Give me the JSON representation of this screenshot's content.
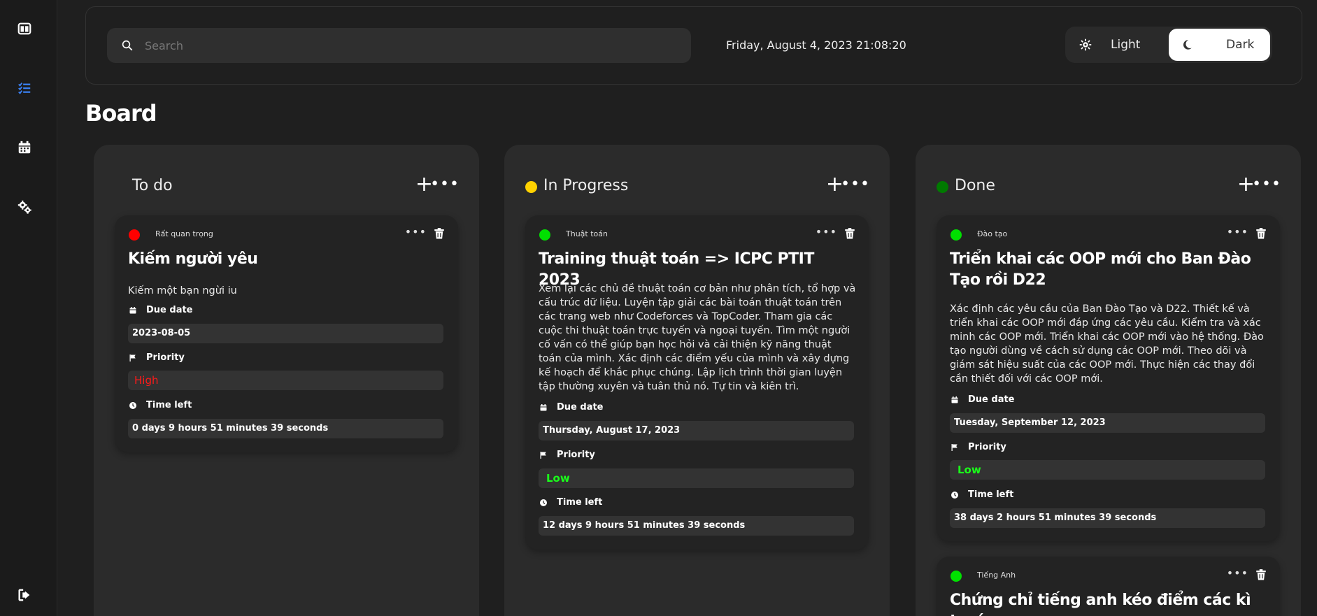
{
  "search": {
    "placeholder": "Search"
  },
  "header": {
    "datetime": "Friday, August 4, 2023 21:08:20"
  },
  "theme": {
    "light_label": "Light",
    "dark_label": "Dark"
  },
  "page": {
    "title": "Board"
  },
  "colors": {
    "red": "#ff0000",
    "green": "#00e000",
    "yellow": "#ffd200",
    "dark_green": "#007a00"
  },
  "columns": [
    {
      "title": "To do",
      "add": "+",
      "more": "•••",
      "cards": [
        {
          "category": "Rất quan trọng",
          "title": "Kiếm người yêu",
          "description": "Kiếm một bạn ngừi iu",
          "due_label": "Due date",
          "due_value": "2023-08-05",
          "priority_label": "Priority",
          "priority_value": "High",
          "time_label": "Time left",
          "time_value": "0 days 9 hours 51 minutes 39 seconds"
        }
      ]
    },
    {
      "title": "In Progress",
      "add": "+",
      "more": "•••",
      "cards": [
        {
          "category": "Thuật toán",
          "title": "Training thuật toán => ICPC PTIT 2023",
          "description": "Xem lại các chủ đề thuật toán cơ bản như phân tích, tổ hợp và cấu trúc dữ liệu. Luyện tập giải các bài toán thuật toán trên các trang web như Codeforces và TopCoder. Tham gia các cuộc thi thuật toán trực tuyến và ngoại tuyến. Tìm một người cố vấn có thể giúp bạn học hỏi và cải thiện kỹ năng thuật toán của mình. Xác định các điểm yếu của mình và xây dựng kế hoạch để khắc phục chúng. Lập lịch trình thời gian luyện tập thường xuyên và tuân thủ nó. Tự tin và kiên trì.",
          "due_label": "Due date",
          "due_value": "Thursday, August 17, 2023",
          "priority_label": "Priority",
          "priority_value": "Low",
          "time_label": "Time left",
          "time_value": "12 days 9 hours 51 minutes 39 seconds"
        }
      ]
    },
    {
      "title": "Done",
      "add": "+",
      "more": "•••",
      "cards": [
        {
          "category": "Đào tạo",
          "title": "Triển khai các OOP mới cho Ban Đào Tạo rồi D22",
          "description": "Xác định các yêu cầu của Ban Đào Tạo và D22. Thiết kế và triển khai các OOP mới đáp ứng các yêu cầu. Kiểm tra và xác minh các OOP mới. Triển khai các OOP mới vào hệ thống. Đào tạo người dùng về cách sử dụng các OOP mới. Theo dõi và giám sát hiệu suất của các OOP mới. Thực hiện các thay đổi cần thiết đối với các OOP mới.",
          "due_label": "Due date",
          "due_value": "Tuesday, September 12, 2023",
          "priority_label": "Priority",
          "priority_value": "Low",
          "time_label": "Time left",
          "time_value": "38 days 2 hours 51 minutes 39 seconds"
        },
        {
          "category": "Tiếng Anh",
          "title": "Chứng chỉ tiếng anh kéo điểm các kì trước"
        }
      ]
    }
  ]
}
